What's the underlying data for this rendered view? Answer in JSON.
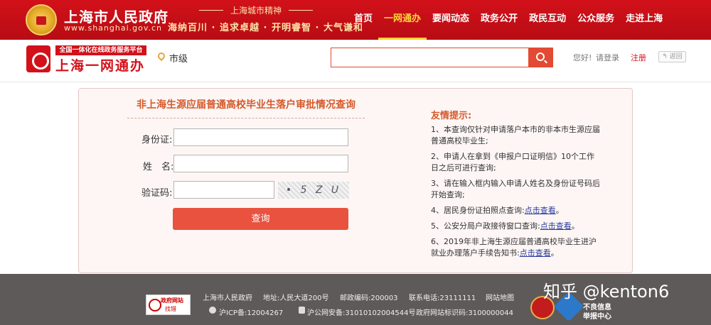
{
  "top_bar": {
    "site_name": "上海市人民政府",
    "site_url": "www.shanghai.gov.cn",
    "spirit_title": "上海城市精神",
    "spirit_slogan": "海纳百川 · 追求卓越 · 开明睿智 · 大气谦和",
    "nav": [
      {
        "label": "首页",
        "active": false
      },
      {
        "label": "一网通办",
        "active": true
      },
      {
        "label": "要闻动态",
        "active": false
      },
      {
        "label": "政务公开",
        "active": false
      },
      {
        "label": "政民互动",
        "active": false
      },
      {
        "label": "公众服务",
        "active": false
      },
      {
        "label": "走进上海",
        "active": false
      }
    ]
  },
  "sub_header": {
    "platform_tag": "全国一体化在线政务服务平台",
    "platform_name": "上海一网通办",
    "location": "市级",
    "search_value": "",
    "greeting": "您好!",
    "login": "请登录",
    "register": "注册",
    "back": "返回"
  },
  "query_form": {
    "title": "非上海生源应届普通高校毕业生落户审批情况查询",
    "id_label": "身份证:",
    "id_value": "",
    "name_label": "姓　名:",
    "name_value": "",
    "captcha_label": "验证码:",
    "captcha_value": "",
    "captcha_text": "• 5 Z U",
    "submit": "查询"
  },
  "tips": {
    "title": "友情提示:",
    "items": [
      {
        "text": "1、本查询仅针对申请落户本市的非本市生源应届普通高校毕业生;",
        "link": ""
      },
      {
        "text": "2、申请人在拿到《申报户口证明信》10个工作日之后可进行查询;",
        "link": ""
      },
      {
        "text": "3、请在输入框内输入申请人姓名及身份证号码后开始查询;",
        "link": ""
      },
      {
        "text": "4、居民身份证拍照点查询:",
        "link": "点击查看",
        "suffix": "。"
      },
      {
        "text": "5、公安分局户政接待窗口查询:",
        "link": "点击查看",
        "suffix": "。"
      },
      {
        "text": "6、2019年非上海生源应届普通高校毕业生进沪就业办理落户手续告知书:",
        "link": "点击查看",
        "suffix": "。"
      }
    ]
  },
  "footer": {
    "badge_title": "政府网站",
    "badge_sub": "找错",
    "org": "上海市人民政府",
    "address": "地址:人民大道200号",
    "postcode": "邮政编码:200003",
    "phone": "联系电话:23111111",
    "sitemap": "网站地图",
    "icp": "沪ICP备:12004267",
    "police": "沪公网安备:31010102004544号",
    "site_id": "政府网站标识码:3100000044",
    "report_title": "不良信息",
    "report_sub": "举报中心",
    "watermark": "知乎 @kenton6"
  }
}
